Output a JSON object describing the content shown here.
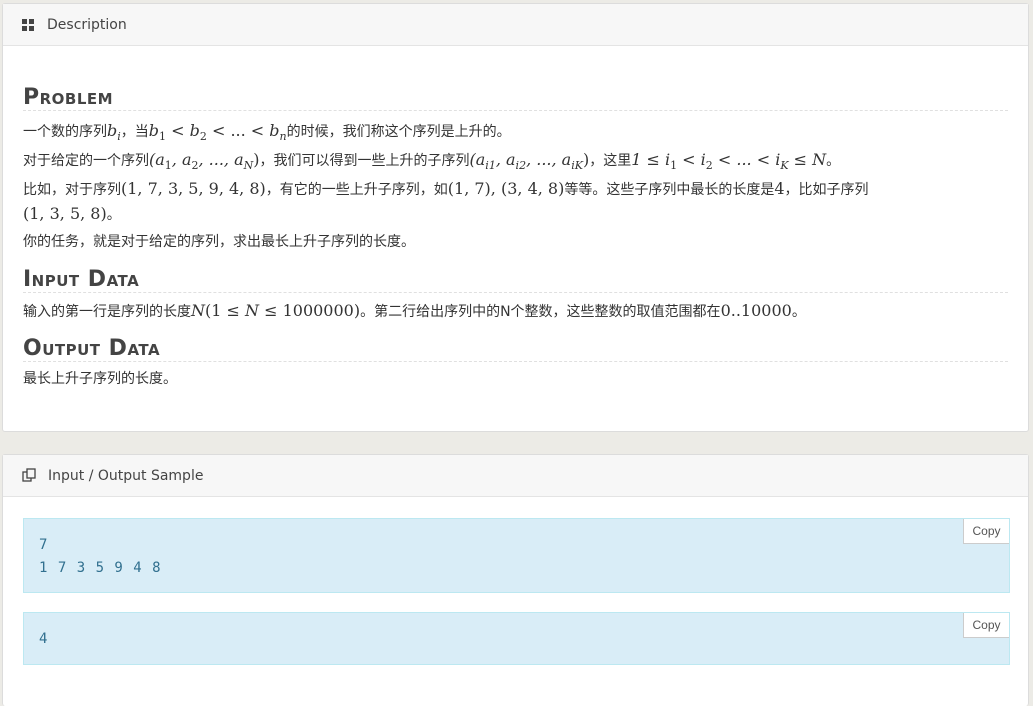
{
  "description_panel": {
    "heading": "Description",
    "sections": {
      "problem": {
        "title": "Problem",
        "lines": [
          [
            "一个数的序列",
            "b",
            "i",
            "，当",
            "b",
            "1",
            " < ",
            "b",
            "2",
            " < ... < ",
            "b",
            "n",
            "的时候，我们称这个序列是上升的。"
          ],
          [
            "对于给定的一个序列",
            "(a",
            "1",
            ", a",
            "2",
            ", ..., a",
            "N",
            ")",
            "，我们可以得到一些上升的子序列",
            "(a",
            "i1",
            ", a",
            "i2",
            ", ..., a",
            "iK",
            ")",
            "，这里",
            "1 ≤ i",
            "1",
            " < i",
            "2",
            " < ... < i",
            "K",
            " ≤ N",
            "。"
          ],
          [
            "比如，对于序列",
            "(1, 7, 3, 5, 9, 4, 8)",
            "，有它的一些上升子序列，如",
            "(1, 7), (3, 4, 8)",
            "等等。这些子序列中最长的长度是",
            "4",
            "，比如子序列"
          ],
          [
            "(1, 3, 5, 8)",
            "。"
          ],
          [
            "你的任务，就是对于给定的序列，求出最长上升子序列的长度。"
          ]
        ]
      },
      "input": {
        "title": "Input Data",
        "parts": [
          "输入的第一行是序列的长度",
          "N",
          "(1 ≤ ",
          "N",
          " ≤ 1000000)",
          "。第二行给出序列中的N个整数，这些整数的取值范围都在",
          "0..10000",
          "。"
        ]
      },
      "output": {
        "title": "Output Data",
        "text": "最长上升子序列的长度。"
      }
    }
  },
  "sample_panel": {
    "heading": "Input / Output Sample",
    "input_sample": "7\n1 7 3 5 9 4 8",
    "output_sample": "4",
    "copy_label": "Copy"
  },
  "icons": {
    "description": "grid-icon",
    "sample": "copy-icon"
  }
}
